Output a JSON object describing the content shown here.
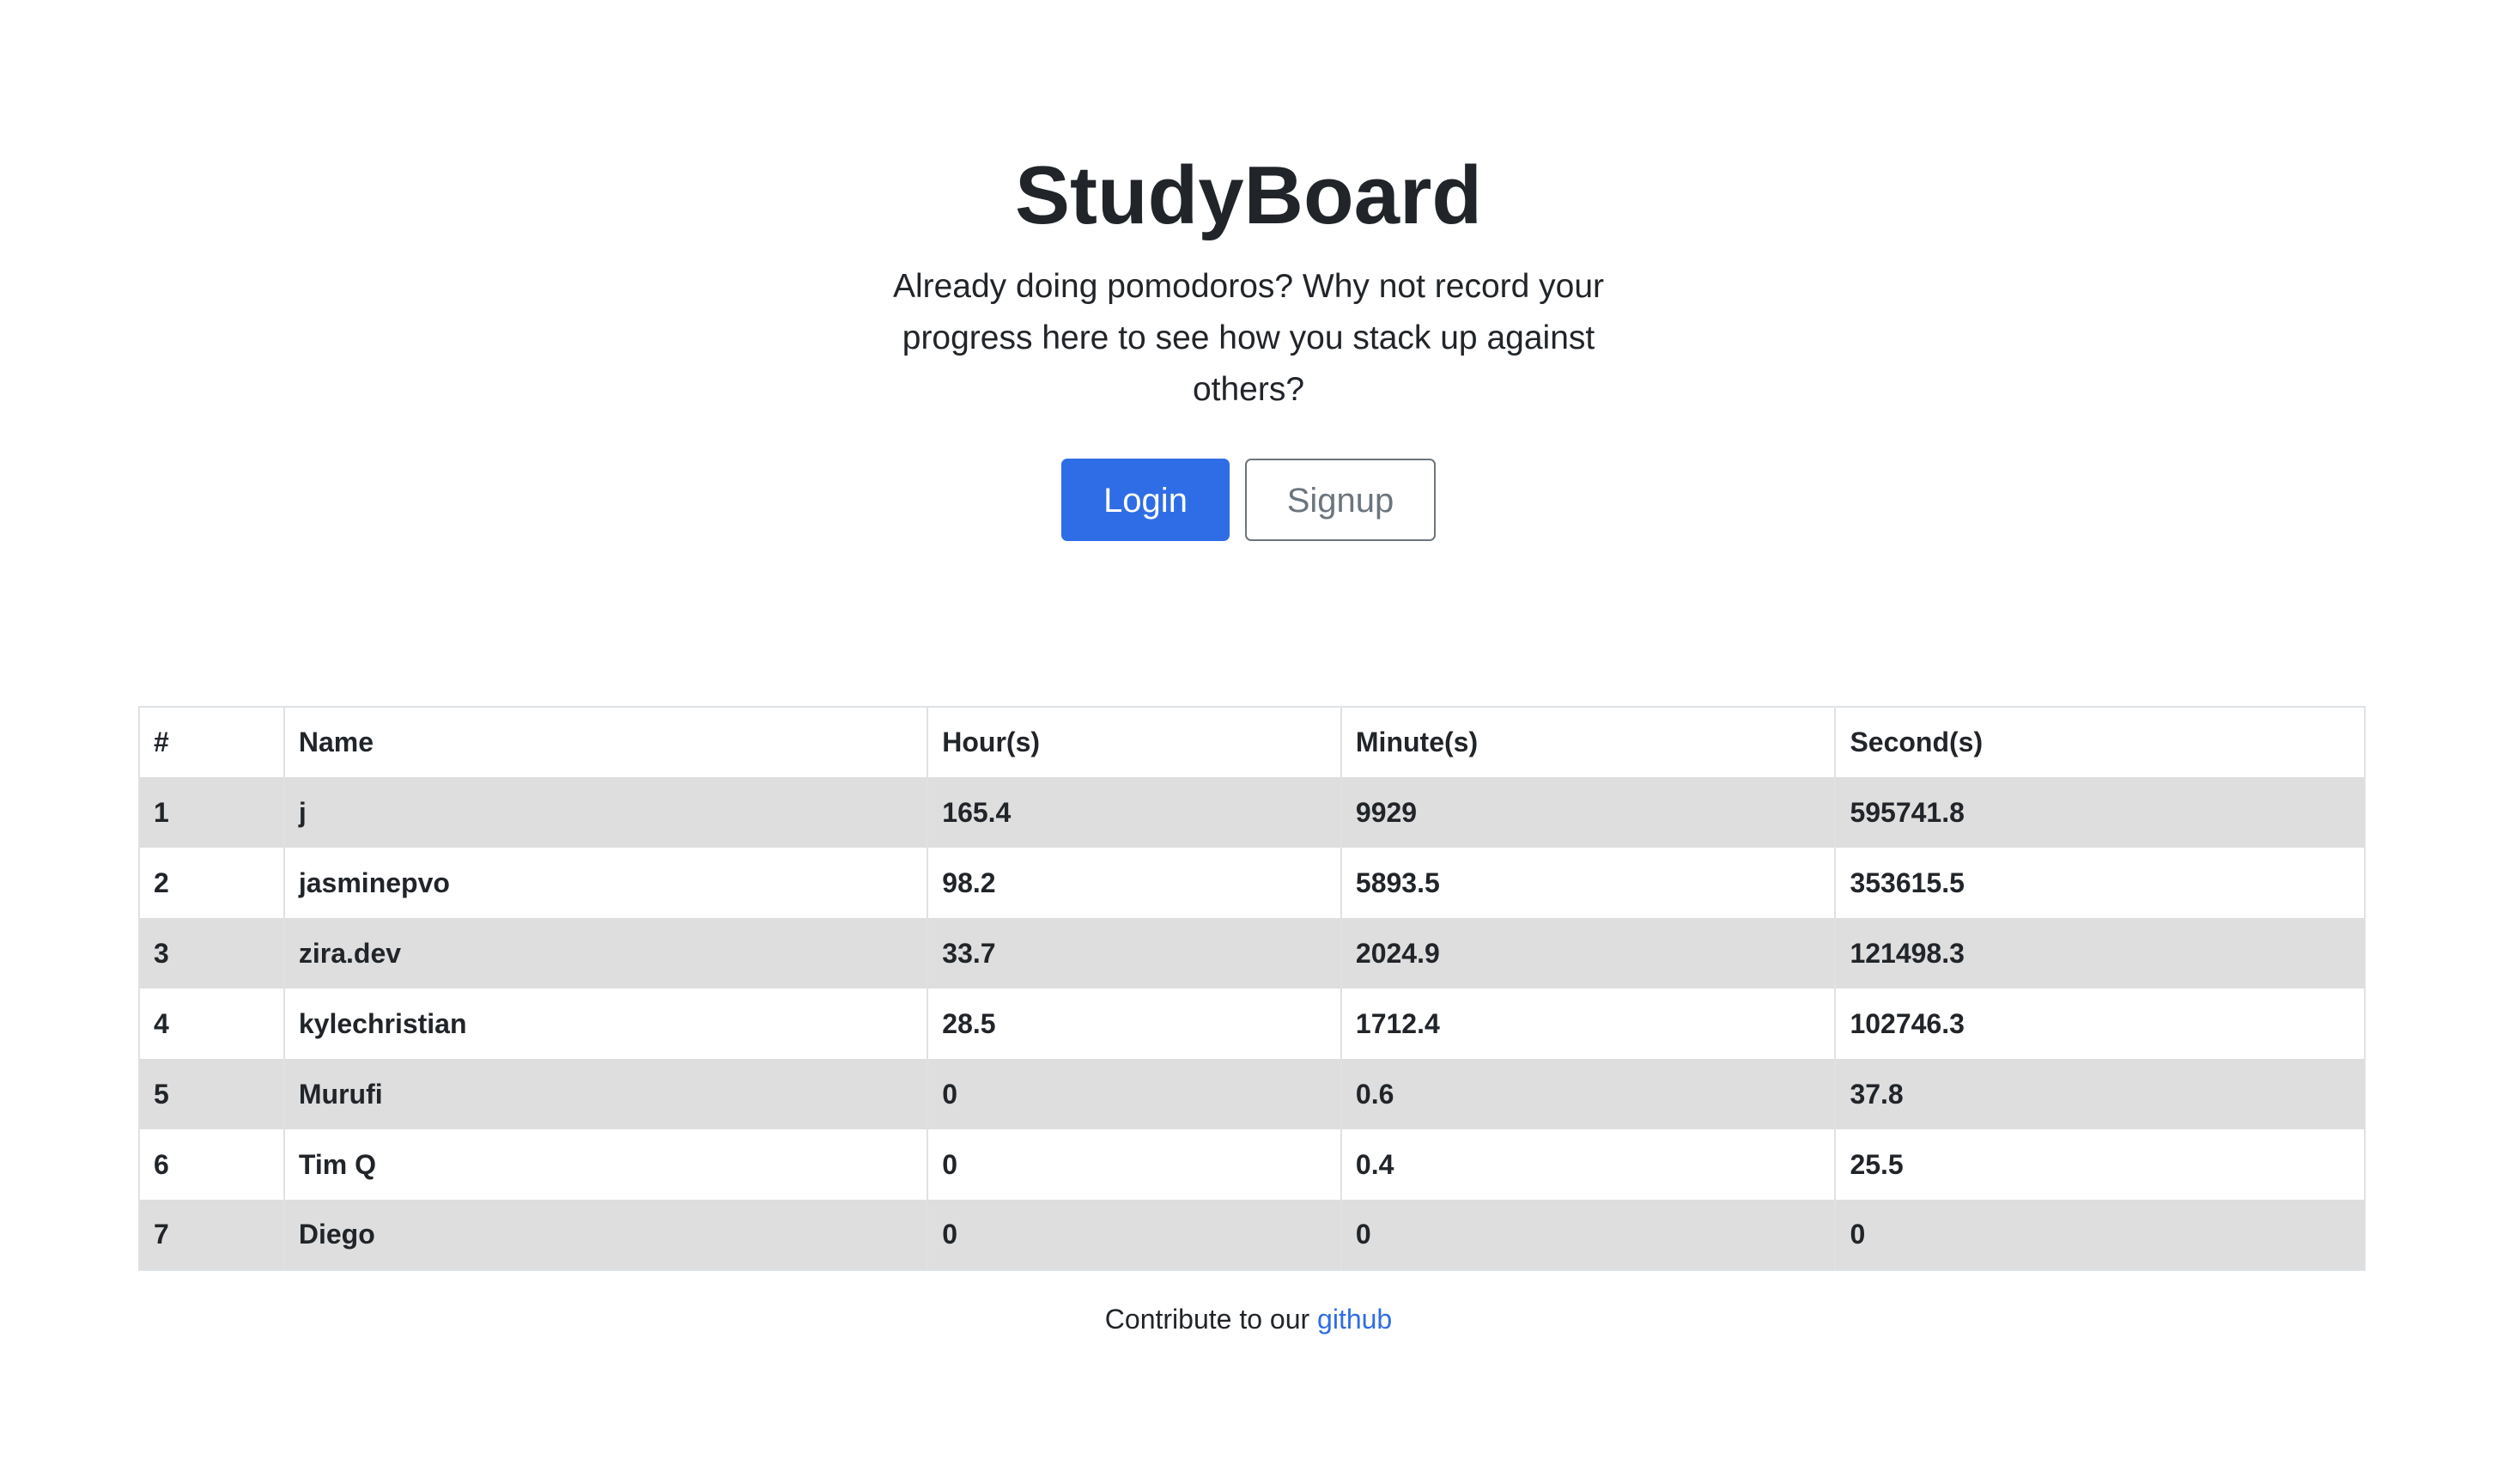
{
  "header": {
    "title": "StudyBoard",
    "tagline": "Already doing pomodoros? Why not record your progress here to see how you stack up against others?",
    "login_label": "Login",
    "signup_label": "Signup"
  },
  "leaderboard": {
    "columns": [
      "#",
      "Name",
      "Hour(s)",
      "Minute(s)",
      "Second(s)"
    ],
    "rows": [
      {
        "rank": "1",
        "name": "j",
        "hours": "165.4",
        "minutes": "9929",
        "seconds": "595741.8"
      },
      {
        "rank": "2",
        "name": "jasminepvo",
        "hours": "98.2",
        "minutes": "5893.5",
        "seconds": "353615.5"
      },
      {
        "rank": "3",
        "name": "zira.dev",
        "hours": "33.7",
        "minutes": "2024.9",
        "seconds": "121498.3"
      },
      {
        "rank": "4",
        "name": "kylechristian",
        "hours": "28.5",
        "minutes": "1712.4",
        "seconds": "102746.3"
      },
      {
        "rank": "5",
        "name": "Murufi",
        "hours": "0",
        "minutes": "0.6",
        "seconds": "37.8"
      },
      {
        "rank": "6",
        "name": "Tim Q",
        "hours": "0",
        "minutes": "0.4",
        "seconds": "25.5"
      },
      {
        "rank": "7",
        "name": "Diego",
        "hours": "0",
        "minutes": "0",
        "seconds": "0"
      }
    ]
  },
  "footer": {
    "text": "Contribute to our",
    "link_label": "github"
  },
  "colors": {
    "primary": "#2f6de6",
    "secondary": "#6c757d",
    "stripe": "#dedede"
  }
}
